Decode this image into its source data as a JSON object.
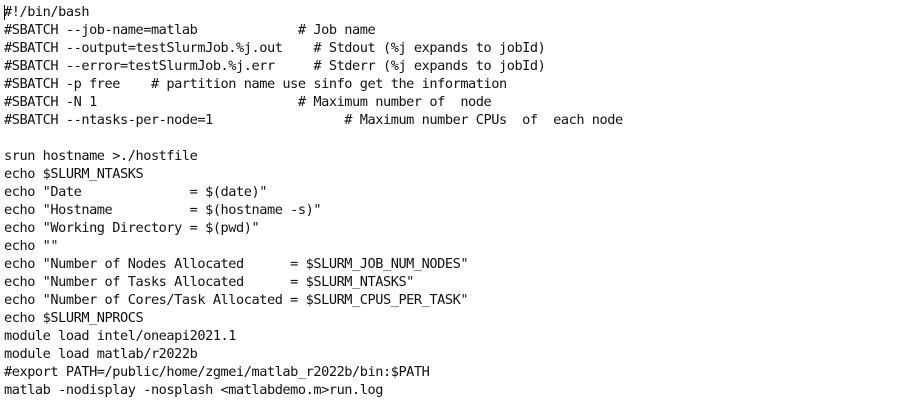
{
  "editor": {
    "lines": [
      "#!/bin/bash",
      "#SBATCH --job-name=matlab             # Job name",
      "#SBATCH --output=testSlurmJob.%j.out    # Stdout (%j expands to jobId)",
      "#SBATCH --error=testSlurmJob.%j.err     # Stderr (%j expands to jobId)",
      "#SBATCH -p free    # partition name use sinfo get the information",
      "#SBATCH -N 1                          # Maximum number of  node",
      "#SBATCH --ntasks-per-node=1                 # Maximum number CPUs  of  each node",
      "",
      "srun hostname >./hostfile",
      "echo $SLURM_NTASKS",
      "echo \"Date              = $(date)\"",
      "echo \"Hostname          = $(hostname -s)\"",
      "echo \"Working Directory = $(pwd)\"",
      "echo \"\"",
      "echo \"Number of Nodes Allocated      = $SLURM_JOB_NUM_NODES\"",
      "echo \"Number of Tasks Allocated      = $SLURM_NTASKS\"",
      "echo \"Number of Cores/Task Allocated = $SLURM_CPUS_PER_TASK\"",
      "echo $SLURM_NPROCS",
      "module load intel/oneapi2021.1",
      "module load matlab/r2022b",
      "#export PATH=/public/home/zgmei/matlab_r2022b/bin:$PATH",
      "matlab -nodisplay -nosplash <matlabdemo.m>run.log"
    ]
  }
}
